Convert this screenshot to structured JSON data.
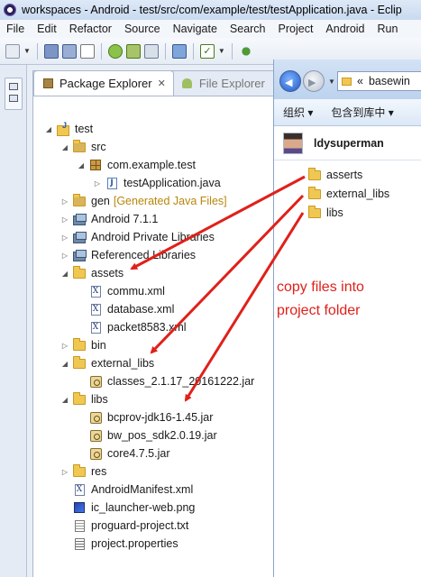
{
  "window": {
    "title": "workspaces - Android - test/src/com/example/test/testApplication.java - Eclip"
  },
  "menu": [
    "File",
    "Edit",
    "Refactor",
    "Source",
    "Navigate",
    "Search",
    "Project",
    "Android",
    "Run"
  ],
  "tabs": {
    "package_explorer": "Package Explorer",
    "file_explorer": "File Explorer",
    "close": "✕"
  },
  "tree": [
    {
      "label": "test",
      "icon": "project",
      "twisty": "open"
    },
    {
      "label": "src",
      "icon": "src-folder",
      "twisty": "open"
    },
    {
      "label": "com.example.test",
      "icon": "package",
      "twisty": "open"
    },
    {
      "label": "testApplication.java",
      "icon": "java-file",
      "twisty": "closed"
    },
    {
      "label": "gen",
      "note": "[Generated Java Files]",
      "icon": "src-folder",
      "twisty": "closed"
    },
    {
      "label": "Android 7.1.1",
      "icon": "library",
      "twisty": "closed"
    },
    {
      "label": "Android Private Libraries",
      "icon": "library",
      "twisty": "closed"
    },
    {
      "label": "Referenced Libraries",
      "icon": "library",
      "twisty": "closed"
    },
    {
      "label": "assets",
      "icon": "folder",
      "twisty": "open"
    },
    {
      "label": "commu.xml",
      "icon": "xml-file"
    },
    {
      "label": "database.xml",
      "icon": "xml-file"
    },
    {
      "label": "packet8583.xml",
      "icon": "xml-file"
    },
    {
      "label": "bin",
      "icon": "folder",
      "twisty": "closed"
    },
    {
      "label": "external_libs",
      "icon": "folder",
      "twisty": "open"
    },
    {
      "label": "classes_2.1.17_20161222.jar",
      "icon": "jar-file"
    },
    {
      "label": "libs",
      "icon": "folder",
      "twisty": "open"
    },
    {
      "label": "bcprov-jdk16-1.45.jar",
      "icon": "jar-file"
    },
    {
      "label": "bw_pos_sdk2.0.19.jar",
      "icon": "jar-file"
    },
    {
      "label": "core4.7.5.jar",
      "icon": "jar-file"
    },
    {
      "label": "res",
      "icon": "folder",
      "twisty": "closed"
    },
    {
      "label": "AndroidManifest.xml",
      "icon": "xml-file"
    },
    {
      "label": "ic_launcher-web.png",
      "icon": "image-file"
    },
    {
      "label": "proguard-project.txt",
      "icon": "text-file"
    },
    {
      "label": "project.properties",
      "icon": "properties-file"
    }
  ],
  "explorer": {
    "address": "basewin",
    "address_prefix": "«",
    "commands": [
      "组织 ▾",
      "包含到库中 ▾"
    ],
    "user": "ldysuperman",
    "folders": [
      "asserts",
      "external_libs",
      "libs"
    ]
  },
  "annotation": {
    "line1": "copy files into",
    "line2": "project folder",
    "color": "#e0201a"
  }
}
